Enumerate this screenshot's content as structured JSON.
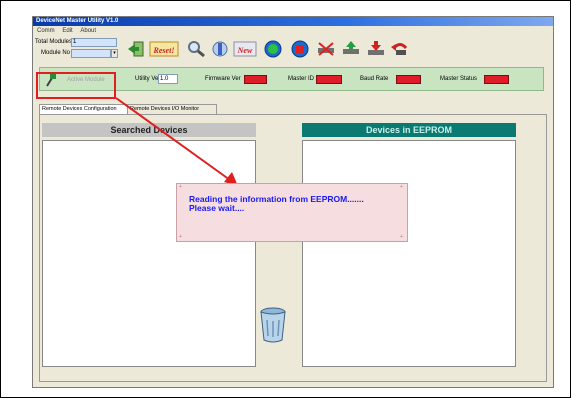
{
  "window": {
    "title": "DeviceNet Master Utility V1.0"
  },
  "menu": [
    "Comm",
    "Edit",
    "About"
  ],
  "top_fields": {
    "total_modules_label": "Total Modules",
    "total_modules_value": "1",
    "module_no_label": "Module No",
    "module_no_value": "",
    "dropdown_arrow": "▾"
  },
  "toolbar": {
    "icons": [
      "exit-icon",
      "reset-icon",
      "search-icon",
      "scan-icon",
      "new-icon",
      "play-icon",
      "stop-icon",
      "remove-icon",
      "add-icon",
      "download-icon",
      "undo-icon"
    ],
    "reset_label": "Reset!",
    "new_label": "New"
  },
  "status": {
    "active_module_label": "Active Module",
    "utility_ver_label": "Utility Ver",
    "utility_ver_value": "1.0",
    "firmware_ver_label": "Firmware Ver",
    "master_id_label": "Master ID",
    "baud_rate_label": "Baud Rate",
    "master_status_label": "Master Status",
    "status_color": "#e01c2a"
  },
  "tabs": [
    "Remote Devices Configuration",
    "Remote Devices I/O Monitor"
  ],
  "lists": {
    "searched_title": "Searched Devices",
    "eeprom_title": "Devices in EEPROM",
    "searched_color": "#c4c4c4",
    "eeprom_color": "#0b7a72"
  },
  "popup": {
    "line1": "Reading the information from EEPROM.......",
    "line2": "Please wait...."
  },
  "annotation": {
    "highlight_color": "#e02020"
  }
}
